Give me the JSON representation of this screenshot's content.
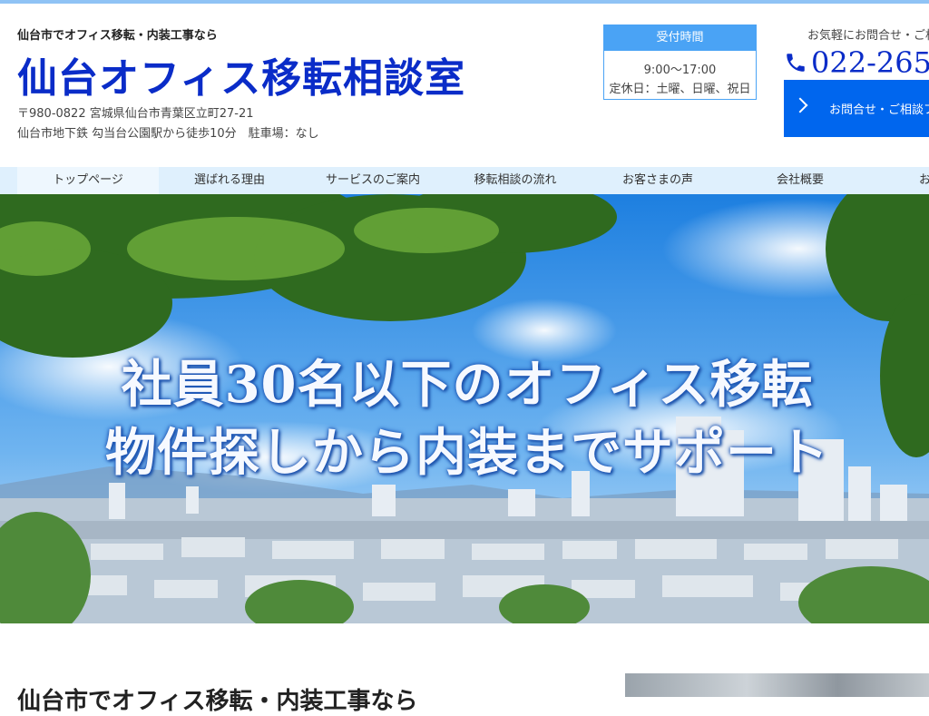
{
  "header": {
    "tagline": "仙台市でオフィス移転・内装工事なら",
    "title": "仙台オフィス移転相談室",
    "address": "〒980-0822 宮城県仙台市青葉区立町27-21",
    "access": "仙台市地下鉄 勾当台公園駅から徒歩10分　駐車場：なし"
  },
  "hours": {
    "heading": "受付時間",
    "time": "9:00〜17:00",
    "closed": "定休日：土曜、日曜、祝日"
  },
  "contact": {
    "note": "お気軽にお問合せ・ご相",
    "phone": "022-265",
    "button_label": "お問合せ・ご相談フ"
  },
  "nav": {
    "items": [
      {
        "label": "トップページ"
      },
      {
        "label": "選ばれる理由"
      },
      {
        "label": "サービスのご案内"
      },
      {
        "label": "移転相談の流れ"
      },
      {
        "label": "お客さまの声"
      },
      {
        "label": "会社概要"
      },
      {
        "label": "お"
      }
    ]
  },
  "hero": {
    "line1": "社員30名以下のオフィス移転",
    "line2": "物件探しから内装までサポート"
  },
  "main": {
    "section_title": "仙台市でオフィス移転・内装工事なら"
  },
  "colors": {
    "brand_blue": "#0a2cc8",
    "accent_blue": "#4aa3f5",
    "button_blue": "#0066ee",
    "nav_bg": "#dff0fd"
  }
}
